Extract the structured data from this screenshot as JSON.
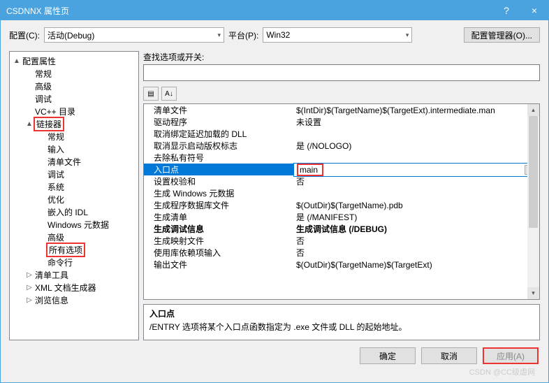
{
  "window": {
    "title": "CSDNNX 属性页",
    "help": "?",
    "close": "×"
  },
  "toolbar": {
    "config_label": "配置(C):",
    "config_value": "活动(Debug)",
    "platform_label": "平台(P):",
    "platform_value": "Win32",
    "manager_label": "配置管理器(O)..."
  },
  "tree": [
    {
      "d": 0,
      "t": "▲",
      "l": "配置属性"
    },
    {
      "d": 1,
      "t": "",
      "l": "常规"
    },
    {
      "d": 1,
      "t": "",
      "l": "高级"
    },
    {
      "d": 1,
      "t": "",
      "l": "调试"
    },
    {
      "d": 1,
      "t": "",
      "l": "VC++ 目录"
    },
    {
      "d": 1,
      "t": "▲",
      "l": "链接器",
      "red": true
    },
    {
      "d": 2,
      "t": "",
      "l": "常规"
    },
    {
      "d": 2,
      "t": "",
      "l": "输入"
    },
    {
      "d": 2,
      "t": "",
      "l": "清单文件"
    },
    {
      "d": 2,
      "t": "",
      "l": "调试"
    },
    {
      "d": 2,
      "t": "",
      "l": "系统"
    },
    {
      "d": 2,
      "t": "",
      "l": "优化"
    },
    {
      "d": 2,
      "t": "",
      "l": "嵌入的 IDL"
    },
    {
      "d": 2,
      "t": "",
      "l": "Windows 元数据"
    },
    {
      "d": 2,
      "t": "",
      "l": "高级"
    },
    {
      "d": 2,
      "t": "",
      "l": "所有选项",
      "red": true
    },
    {
      "d": 2,
      "t": "",
      "l": "命令行"
    },
    {
      "d": 1,
      "t": "▷",
      "l": "清单工具"
    },
    {
      "d": 1,
      "t": "▷",
      "l": "XML 文档生成器"
    },
    {
      "d": 1,
      "t": "▷",
      "l": "浏览信息"
    }
  ],
  "search_label": "查找选项或开关:",
  "sorticons": [
    "▤",
    "A↓"
  ],
  "props": [
    {
      "k": "清单文件",
      "v": "$(IntDir)$(TargetName)$(TargetExt).intermediate.man"
    },
    {
      "k": "驱动程序",
      "v": "未设置"
    },
    {
      "k": "取消绑定延迟加载的 DLL",
      "v": ""
    },
    {
      "k": "取消显示启动版权标志",
      "v": "是 (/NOLOGO)"
    },
    {
      "k": "去除私有符号",
      "v": ""
    },
    {
      "k": "入口点",
      "v": "main",
      "sel": true,
      "redv": true
    },
    {
      "k": "设置校验和",
      "v": "否"
    },
    {
      "k": "生成 Windows 元数据",
      "v": ""
    },
    {
      "k": "生成程序数据库文件",
      "v": "$(OutDir)$(TargetName).pdb"
    },
    {
      "k": "生成清单",
      "v": "是 (/MANIFEST)"
    },
    {
      "k": "生成调试信息",
      "v": "生成调试信息 (/DEBUG)",
      "bold": true
    },
    {
      "k": "生成映射文件",
      "v": "否"
    },
    {
      "k": "使用库依赖项输入",
      "v": "否"
    },
    {
      "k": "输出文件",
      "v": "$(OutDir)$(TargetName)$(TargetExt)"
    }
  ],
  "desc": {
    "title": "入口点",
    "body": "/ENTRY 选项将某个入口点函数指定为 .exe 文件或 DLL 的起始地址。"
  },
  "footer": {
    "ok": "确定",
    "cancel": "取消",
    "apply": "应用(A)"
  },
  "watermark": "CSDN @CC级虐网"
}
